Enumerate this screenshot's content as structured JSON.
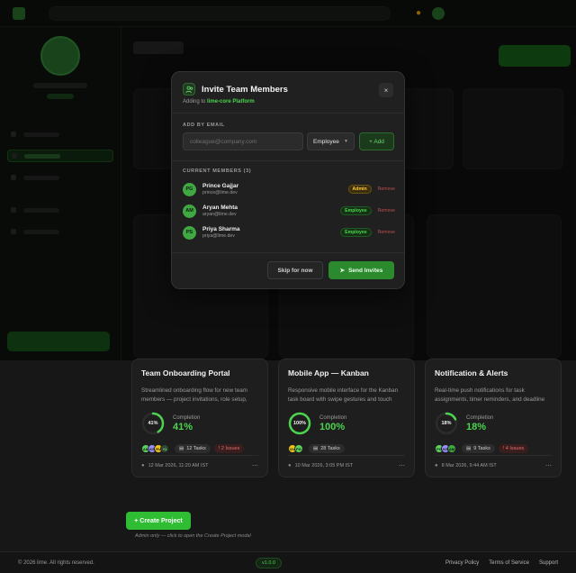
{
  "modal": {
    "title": "Invite Team Members",
    "subtitle_prefix": "Adding to",
    "project_name": "lime-core Platform",
    "close_icon": "×",
    "add_by_email_label": "ADD BY EMAIL",
    "email_placeholder": "colleague@company.com",
    "role_selected": "Employee",
    "add_label": "+ Add",
    "current_members_label": "CURRENT MEMBERS (3)",
    "members": [
      {
        "initials": "PG",
        "name": "Prince Gajjar",
        "email": "prince@lime.dev",
        "role": "Admin",
        "remove": "Remove"
      },
      {
        "initials": "AM",
        "name": "Aryan Mehta",
        "email": "aryan@lime.dev",
        "role": "Employee",
        "remove": "Remove"
      },
      {
        "initials": "PS",
        "name": "Priya Sharma",
        "email": "priya@lime.dev",
        "role": "Employee",
        "remove": "Remove"
      }
    ],
    "skip_label": "Skip for now",
    "send_label": "Send Invites"
  },
  "cards": [
    {
      "title": "Team Onboarding Portal",
      "description": "Streamlined onboarding flow for new team members — project invitations, role setup, and...",
      "completion_label": "Completion",
      "completion": 41,
      "completion_text": "41%",
      "avatars": [
        "AM",
        "KS",
        "RV",
        "+1"
      ],
      "tasks": "12 Tasks",
      "issues": "! 2 Issues",
      "date": "12 Mar 2026, 11:20 AM IST"
    },
    {
      "title": "Mobile App — Kanban",
      "description": "Responsive mobile interface for the Kanban task board with swipe gestures and touch quick-...",
      "completion_label": "Completion",
      "completion": 100,
      "completion_text": "100%",
      "avatars": [
        "DV",
        "PG"
      ],
      "tasks": "28 Tasks",
      "issues": "",
      "date": "10 Mar 2026, 3:05 PM IST"
    },
    {
      "title": "Notification & Alerts",
      "description": "Real-time push notifications for task assignments, timer reminders, and deadline alerts across...",
      "completion_label": "Completion",
      "completion": 18,
      "completion_text": "18%",
      "avatars": [
        "PG",
        "KS",
        "AM"
      ],
      "tasks": "9 Tasks",
      "issues": "! 4 Issues",
      "date": "8 Mar 2026, 9:44 AM IST"
    }
  ],
  "create": {
    "label": "+ Create Project",
    "hint": "Admin only — click to open the Create Project modal"
  },
  "footer": {
    "copyright": "© 2026 lime. All rights reserved.",
    "version": "v1.0.0",
    "links": [
      "Privacy Policy",
      "Terms of Service",
      "Support"
    ]
  },
  "colors": {
    "accent": "#4cd44f",
    "button": "#2fbd34",
    "admin": "#ffc940",
    "danger": "#e07070"
  },
  "icons": {
    "invite": "users-icon",
    "close": "close-icon",
    "send": "send-icon",
    "clock": "clock-icon",
    "tasks": "list-icon",
    "menu": "kebab-icon"
  }
}
